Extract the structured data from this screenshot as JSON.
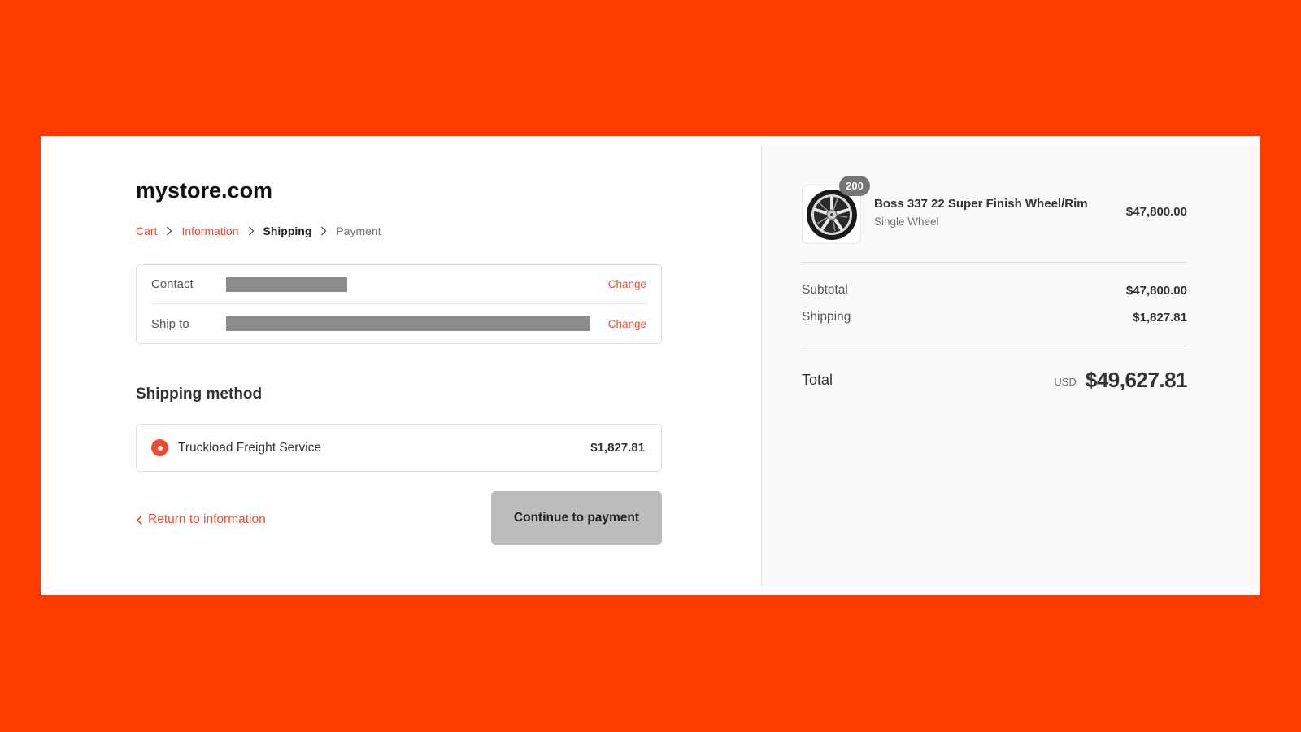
{
  "store": {
    "name": "mystore.com"
  },
  "breadcrumb": {
    "items": [
      {
        "label": "Cart",
        "state": "link"
      },
      {
        "label": "Information",
        "state": "link"
      },
      {
        "label": "Shipping",
        "state": "current"
      },
      {
        "label": "Payment",
        "state": "future"
      }
    ]
  },
  "review": {
    "contact_label": "Contact",
    "ship_to_label": "Ship to",
    "change_label": "Change"
  },
  "shipping_method": {
    "heading": "Shipping method",
    "option_name": "Truckload Freight Service",
    "option_price": "$1,827.81"
  },
  "actions": {
    "return_label": "Return to information",
    "continue_label": "Continue to payment"
  },
  "summary": {
    "product": {
      "quantity": "200",
      "name": "Boss 337 22 Super Finish Wheel/Rim",
      "variant": "Single Wheel",
      "price": "$47,800.00"
    },
    "subtotal_label": "Subtotal",
    "subtotal_value": "$47,800.00",
    "shipping_label": "Shipping",
    "shipping_value": "$1,827.81",
    "total_label": "Total",
    "currency": "USD",
    "total_value": "$49,627.81"
  },
  "colors": {
    "background": "#ff3c00",
    "accent": "#ee4a32",
    "button_disabled": "#bcbcbc",
    "summary_panel": "#fafafa"
  },
  "icons": [
    "chevron-right-icon",
    "chevron-left-icon",
    "radio-selected-icon",
    "wheel-rim-image"
  ]
}
